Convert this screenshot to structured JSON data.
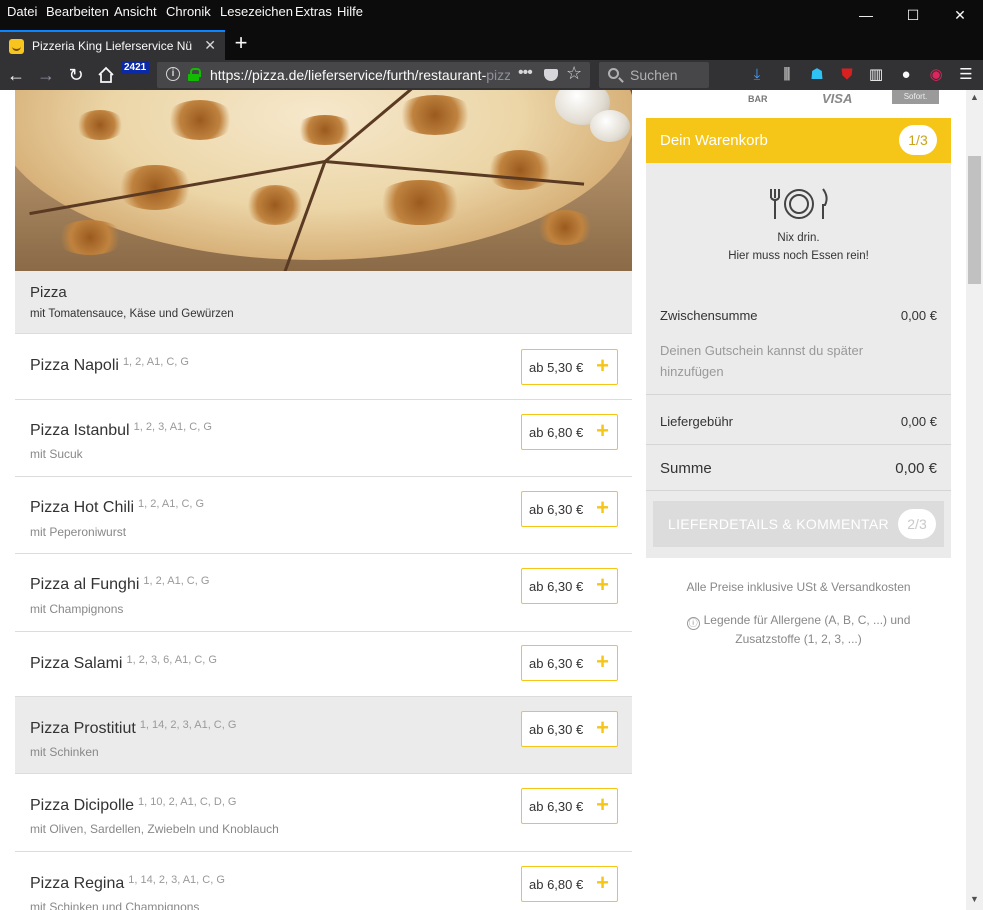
{
  "menubar": {
    "items": [
      "Datei",
      "Bearbeiten",
      "Ansicht",
      "Chronik",
      "Lesezeichen",
      "Extras",
      "Hilfe"
    ]
  },
  "window": {
    "minimize": "—",
    "maximize": "☐",
    "close": "✕"
  },
  "tab": {
    "title": "Pizzeria King Lieferservice Nürnberg",
    "close": "✕",
    "new_tab": "+"
  },
  "nav": {
    "badge": "2421",
    "url_main": "https://pizza.de/lieferservice/furth/restaurant-",
    "url_fade": "pizzeria-king",
    "dots": "•••",
    "search_placeholder": "Suchen"
  },
  "payments": {
    "bar": "BAR",
    "visa": "VISA",
    "sofort": "Sofort."
  },
  "category": {
    "name": "Pizza",
    "desc": "mit Tomatensauce, Käse und Gewürzen"
  },
  "dishes": [
    {
      "name": "Pizza Napoli",
      "codes": "1, 2, A1, C, G",
      "desc": "",
      "price": "ab 5,30 €"
    },
    {
      "name": "Pizza Istanbul",
      "codes": "1, 2, 3, A1, C, G",
      "desc": "mit Sucuk",
      "price": "ab 6,80 €"
    },
    {
      "name": "Pizza Hot Chili",
      "codes": "1, 2, A1, C, G",
      "desc": "mit Peperoniwurst",
      "price": "ab 6,30 €"
    },
    {
      "name": "Pizza al Funghi",
      "codes": "1, 2, A1, C, G",
      "desc": "mit Champignons",
      "price": "ab 6,30 €"
    },
    {
      "name": "Pizza Salami",
      "codes": "1, 2, 3, 6, A1, C, G",
      "desc": "",
      "price": "ab 6,30 €"
    },
    {
      "name": "Pizza Prostitiut",
      "codes": "1, 14, 2, 3, A1, C, G",
      "desc": "mit Schinken",
      "price": "ab 6,30 €"
    },
    {
      "name": "Pizza Dicipolle",
      "codes": "1, 10, 2, A1, C, D, G",
      "desc": "mit Oliven, Sardellen, Zwiebeln und Knoblauch",
      "price": "ab 6,30 €"
    },
    {
      "name": "Pizza Regina",
      "codes": "1, 14, 2, 3, A1, C, G",
      "desc": "mit Schinken und Champignons",
      "price": "ab 6,80 €"
    }
  ],
  "cart": {
    "title": "Dein Warenkorb",
    "step1": "1/3",
    "empty_line1": "Nix drin.",
    "empty_line2": "Hier muss noch Essen rein!",
    "subtotal_label": "Zwischensumme",
    "subtotal_value": "0,00 €",
    "voucher_text": "Deinen Gutschein kannst du später hinzufügen",
    "delivery_label": "Liefergebühr",
    "delivery_value": "0,00 €",
    "sum_label": "Summe",
    "sum_value": "0,00 €",
    "details_button": "LIEFERDETAILS & KOMMENTAR",
    "step2": "2/3",
    "prices_note": "Alle Preise inklusive USt & Versandkosten",
    "legend_note": "Legende für Allergene (A, B, C, ...) und Zusatzstoffe (1, 2, 3, ...)"
  },
  "colors": {
    "accent": "#f5c518",
    "browser_dark": "#0c0c0d",
    "browser_toolbar": "#323234",
    "tab_accent": "#0a84ff"
  }
}
